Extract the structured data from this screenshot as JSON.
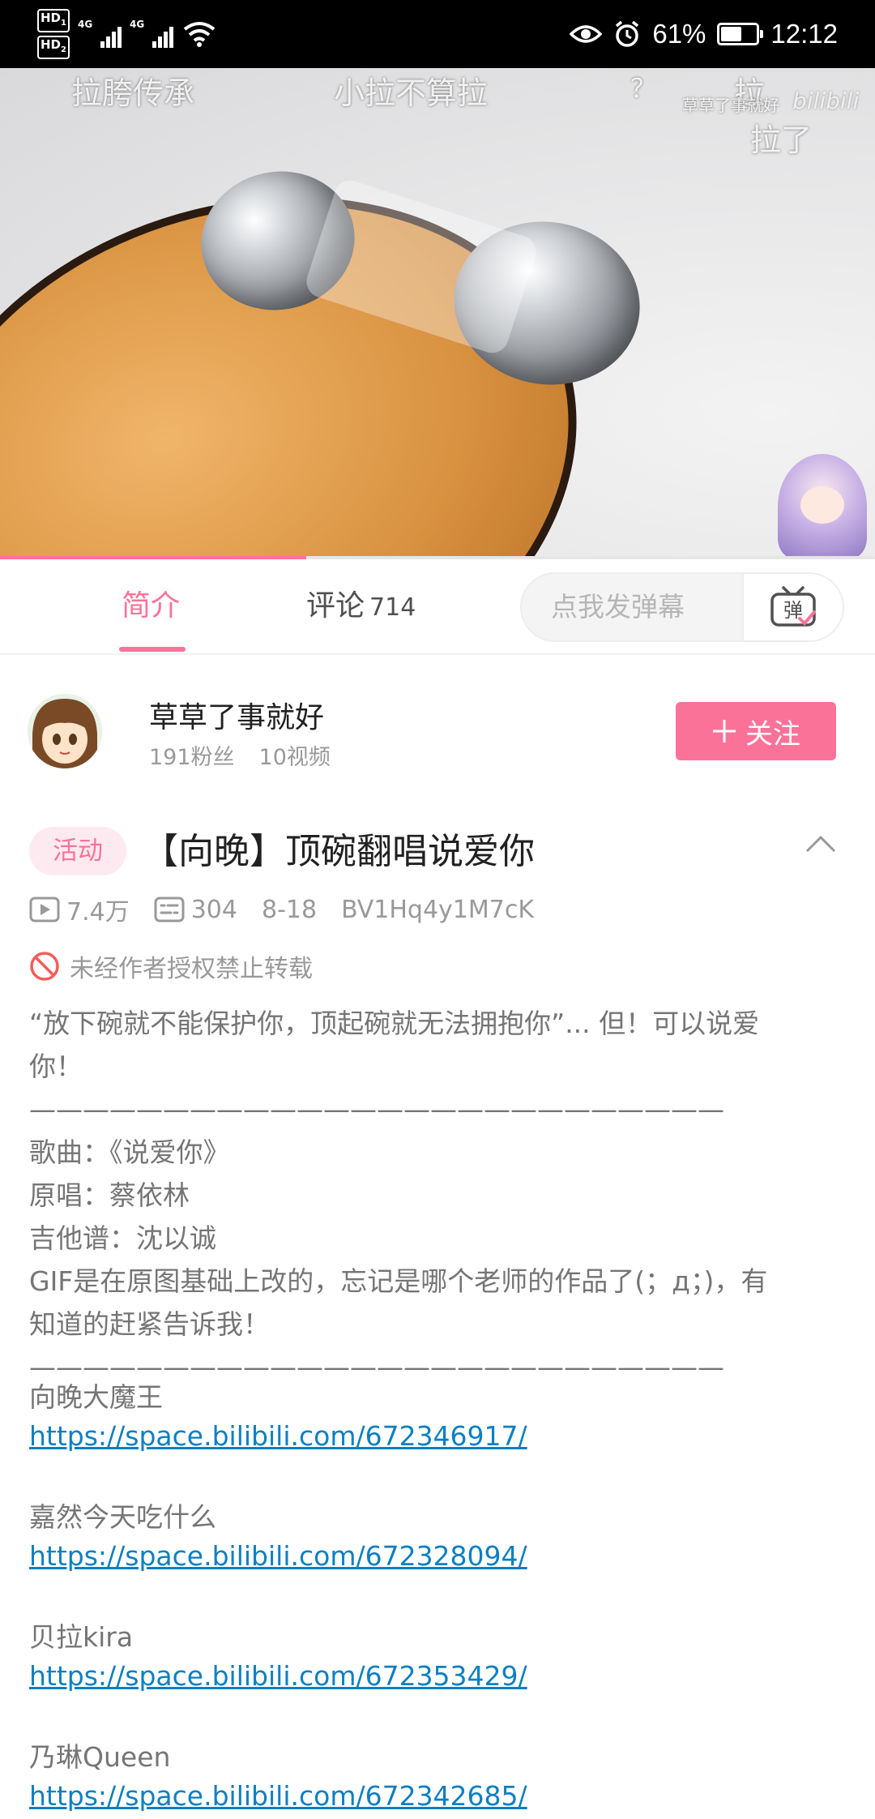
{
  "status_bar": {
    "hd1": "HD",
    "hd1_sub": "1",
    "hd2": "HD",
    "hd2_sub": "2",
    "net1": "4G",
    "net2": "4G",
    "battery": "61%",
    "battery_level": 0.61,
    "time": "12:12"
  },
  "video": {
    "danmaku": [
      "拉胯传承",
      "小拉不算拉",
      "？",
      "拉",
      "拉了",
      "草草了事就好"
    ],
    "watermark": "bilibili",
    "progress": 0.35
  },
  "tabs": {
    "intro": "简介",
    "comments": "评论",
    "comments_count": "714",
    "danmaku_placeholder": "点我发弹幕",
    "danmaku_button": "弹"
  },
  "uploader": {
    "name": "草草了事就好",
    "fans": "191粉丝",
    "videos": "10视频",
    "follow": "关注"
  },
  "video_info": {
    "tag": "活动",
    "title": "【向晚】顶碗翻唱说爱你",
    "views": "7.4万",
    "danmaku": "304",
    "date": "8-18",
    "bvid": "BV1Hq4y1M7cK",
    "copyright": "未经作者授权禁止转载"
  },
  "description": {
    "quote_1": "“放下碗就不能保护你，顶起碗就无法拥抱你”... 但！可以说爱",
    "quote_2": "你！",
    "divider": "——————————————————————————",
    "song": "歌曲：《说爱你》",
    "original": "原唱：蔡依林",
    "tab": "吉他谱：沈以诚",
    "gif_1": "GIF是在原图基础上改的，忘记是哪个老师的作品了(；д；)，有",
    "gif_2": "知道的赶紧告诉我！",
    "divider2": "——————————————————————————",
    "links": [
      {
        "name": "向晚大魔王",
        "url": "https://space.bilibili.com/672346917/"
      },
      {
        "name": "嘉然今天吃什么",
        "url": "https://space.bilibili.com/672328094/"
      },
      {
        "name": "贝拉kira",
        "url": "https://space.bilibili.com/672353429/"
      },
      {
        "name": "乃琳Queen",
        "url": "https://space.bilibili.com/672342685/"
      }
    ]
  },
  "colors": {
    "accent": "#fb7299",
    "link": "#0d7fc3",
    "muted": "#999999"
  }
}
